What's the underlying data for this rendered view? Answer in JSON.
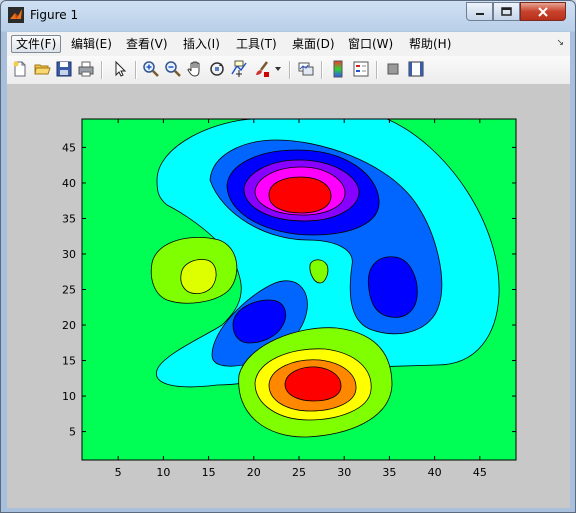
{
  "window": {
    "title": "Figure 1"
  },
  "menus": [
    "文件(F)",
    "编辑(E)",
    "查看(V)",
    "插入(I)",
    "工具(T)",
    "桌面(D)",
    "窗口(W)",
    "帮助(H)"
  ],
  "toolbar_icons": [
    "new-figure-icon",
    "open-file-icon",
    "save-icon",
    "print-icon",
    "select-arrow-icon",
    "zoom-in-icon",
    "zoom-out-icon",
    "pan-hand-icon",
    "rotate-3d-icon",
    "data-cursor-icon",
    "brush-icon",
    "link-plot-icon",
    "colorbar-icon",
    "legend-icon",
    "hide-plot-tools-icon",
    "show-plot-tools-icon"
  ],
  "chart_data": {
    "type": "contourf",
    "xlim": [
      1,
      49
    ],
    "ylim": [
      1,
      49
    ],
    "xticks": [
      5,
      10,
      15,
      20,
      25,
      30,
      35,
      40,
      45
    ],
    "yticks": [
      5,
      10,
      15,
      20,
      25,
      30,
      35,
      40,
      45
    ],
    "background_level_color": "#00ff55",
    "colormap": "hsv",
    "features": [
      {
        "kind": "peak",
        "x": 27,
        "y": 12,
        "colors": [
          "#80ff00",
          "#ffff00",
          "#ff8800",
          "#ff0000"
        ]
      },
      {
        "kind": "trough",
        "x": 25,
        "y": 38,
        "colors": [
          "#00ffff",
          "#0066ff",
          "#0000ff",
          "#8800ff",
          "#ff00ff",
          "#ff0000"
        ]
      },
      {
        "kind": "peak",
        "x": 14,
        "y": 27,
        "colors": [
          "#80ff00",
          "#ddff00"
        ]
      },
      {
        "kind": "trough",
        "x": 20,
        "y": 21,
        "colors": [
          "#0066ff",
          "#0000ff"
        ]
      },
      {
        "kind": "trough",
        "x": 36,
        "y": 25,
        "colors": [
          "#0066ff",
          "#0000ff"
        ]
      },
      {
        "kind": "peak",
        "x": 28,
        "y": 26,
        "colors": [
          "#80ff00"
        ]
      }
    ]
  }
}
